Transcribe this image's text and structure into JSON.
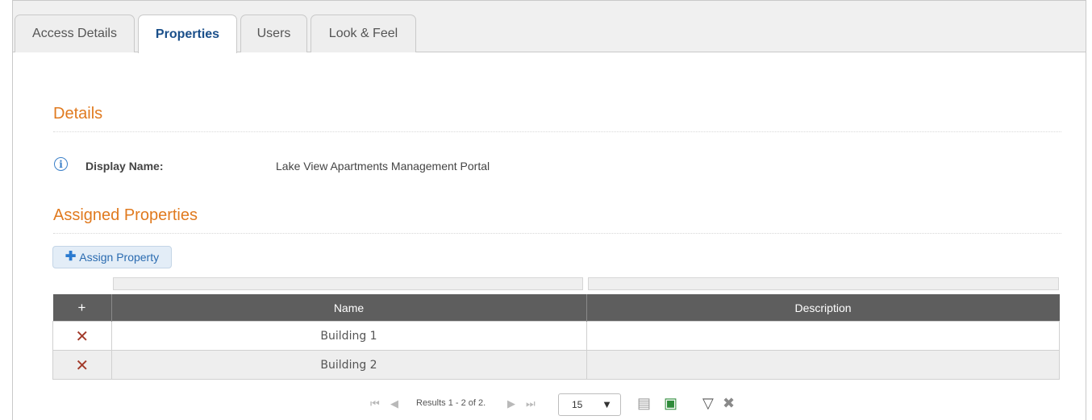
{
  "tabs": [
    {
      "label": "Access Details",
      "active": false
    },
    {
      "label": "Properties",
      "active": true
    },
    {
      "label": "Users",
      "active": false
    },
    {
      "label": "Look & Feel",
      "active": false
    }
  ],
  "details": {
    "title": "Details",
    "display_name_label": "Display Name:",
    "display_name_value": "Lake View Apartments Management Portal"
  },
  "assigned": {
    "title": "Assigned Properties",
    "assign_button_label": "Assign Property"
  },
  "grid": {
    "add_header": "+",
    "columns": [
      "Name",
      "Description"
    ],
    "rows": [
      {
        "name": "Building 1",
        "description": ""
      },
      {
        "name": "Building 2",
        "description": ""
      }
    ],
    "delete_glyph": "✕"
  },
  "pager": {
    "results_text": "Results 1 - 2 of 2.",
    "page_size": "15"
  },
  "colors": {
    "section_title": "#e07a1f",
    "active_tab_text": "#1a4f8a",
    "grid_header_bg": "#5e5e5e",
    "delete_icon": "#a23a2a",
    "excel_icon": "#2e8b3a"
  }
}
